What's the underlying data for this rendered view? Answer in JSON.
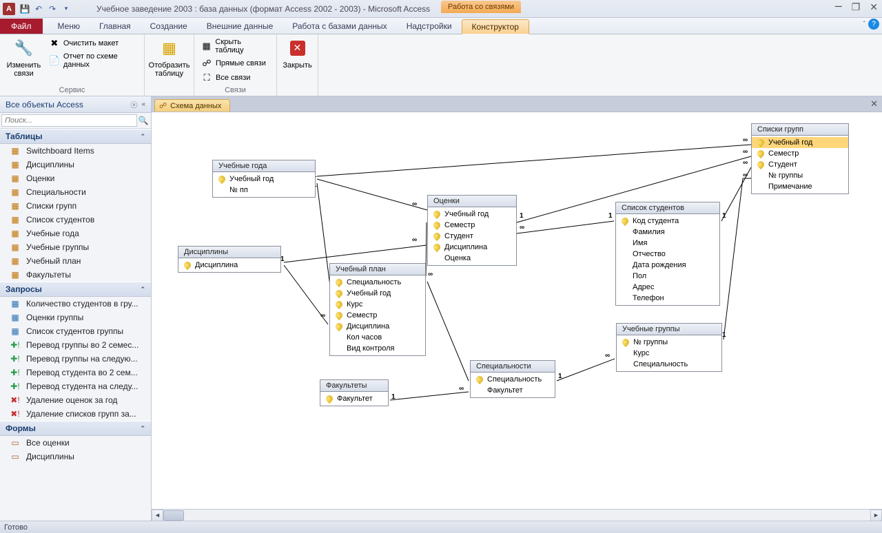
{
  "title": "Учебное заведение 2003 : база данных (формат Access 2002 - 2003)  -  Microsoft Access",
  "context_tab_group": "Работа со связями",
  "tabs": {
    "file": "Файл",
    "items": [
      "Меню",
      "Главная",
      "Создание",
      "Внешние данные",
      "Работа с базами данных",
      "Надстройки"
    ],
    "active": "Конструктор"
  },
  "ribbon": {
    "group1": {
      "label": "Сервис",
      "edit_relations": "Изменить связи",
      "clear_layout": "Очистить макет",
      "relations_report": "Отчет по схеме данных"
    },
    "group2": {
      "show_table": "Отобразить таблицу"
    },
    "group3": {
      "label": "Связи",
      "hide_table": "Скрыть таблицу",
      "direct_relations": "Прямые связи",
      "all_relations": "Все связи"
    },
    "group4": {
      "close": "Закрыть"
    }
  },
  "nav": {
    "header": "Все объекты Access",
    "search_placeholder": "Поиск...",
    "cat_tables": "Таблицы",
    "tables": [
      "Switchboard Items",
      "Дисциплины",
      "Оценки",
      "Специальности",
      "Списки групп",
      "Список студентов",
      "Учебные года",
      "Учебные группы",
      "Учебный план",
      "Факультеты"
    ],
    "cat_queries": "Запросы",
    "queries": [
      {
        "t": "Количество студентов в гру...",
        "k": "q"
      },
      {
        "t": "Оценки группы",
        "k": "q"
      },
      {
        "t": "Список студентов группы",
        "k": "q"
      },
      {
        "t": "Перевод группы во 2 семес...",
        "k": "a"
      },
      {
        "t": "Перевод группы на следую...",
        "k": "a"
      },
      {
        "t": "Перевод студента во 2 сем...",
        "k": "a"
      },
      {
        "t": "Перевод студента на следу...",
        "k": "a"
      },
      {
        "t": "Удаление оценок за год",
        "k": "d"
      },
      {
        "t": "Удаление списков групп за...",
        "k": "d"
      }
    ],
    "cat_forms": "Формы",
    "forms": [
      "Все оценки",
      "Дисциплины"
    ]
  },
  "doc_tab": "Схема данных",
  "diagram": {
    "t_years": {
      "title": "Учебные года",
      "fields": [
        {
          "n": "Учебный год",
          "k": true
        },
        {
          "n": "№ пп",
          "k": false
        }
      ]
    },
    "t_disc": {
      "title": "Дисциплины",
      "fields": [
        {
          "n": "Дисциплина",
          "k": true
        }
      ]
    },
    "t_grades": {
      "title": "Оценки",
      "fields": [
        {
          "n": "Учебный год",
          "k": true
        },
        {
          "n": "Семестр",
          "k": true
        },
        {
          "n": "Студент",
          "k": true
        },
        {
          "n": "Дисциплина",
          "k": true
        },
        {
          "n": "Оценка",
          "k": false
        }
      ]
    },
    "t_plan": {
      "title": "Учебный план",
      "fields": [
        {
          "n": "Специальность",
          "k": true
        },
        {
          "n": "Учебный год",
          "k": true
        },
        {
          "n": "Курс",
          "k": true
        },
        {
          "n": "Семестр",
          "k": true
        },
        {
          "n": "Дисциплина",
          "k": true
        },
        {
          "n": "Кол часов",
          "k": false
        },
        {
          "n": "Вид контроля",
          "k": false
        }
      ]
    },
    "t_fac": {
      "title": "Факультеты",
      "fields": [
        {
          "n": "Факультет",
          "k": true
        }
      ]
    },
    "t_spec": {
      "title": "Специальности",
      "fields": [
        {
          "n": "Специальность",
          "k": true
        },
        {
          "n": "Факультет",
          "k": false
        }
      ]
    },
    "t_students": {
      "title": "Список студентов",
      "fields": [
        {
          "n": "Код студента",
          "k": true
        },
        {
          "n": "Фамилия",
          "k": false
        },
        {
          "n": "Имя",
          "k": false
        },
        {
          "n": "Отчество",
          "k": false
        },
        {
          "n": "Дата рождения",
          "k": false
        },
        {
          "n": "Пол",
          "k": false
        },
        {
          "n": "Адрес",
          "k": false
        },
        {
          "n": "Телефон",
          "k": false
        }
      ]
    },
    "t_groups": {
      "title": "Учебные группы",
      "fields": [
        {
          "n": "№ группы",
          "k": true
        },
        {
          "n": "Курс",
          "k": false
        },
        {
          "n": "Специальность",
          "k": false
        }
      ]
    },
    "t_lists": {
      "title": "Списки групп",
      "fields": [
        {
          "n": "Учебный год",
          "k": true,
          "sel": true
        },
        {
          "n": "Семестр",
          "k": true
        },
        {
          "n": "Студент",
          "k": true
        },
        {
          "n": "№ группы",
          "k": false
        },
        {
          "n": "Примечание",
          "k": false
        }
      ]
    }
  },
  "status": "Готово",
  "rel_one": "1",
  "rel_many": "∞"
}
